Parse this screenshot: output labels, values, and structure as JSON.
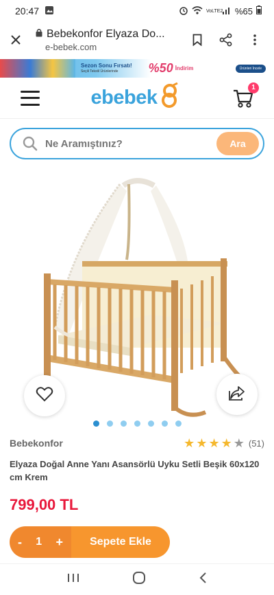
{
  "status_bar": {
    "time": "20:47",
    "battery": "%65",
    "network": "VoLTE2"
  },
  "browser": {
    "page_title": "Bebekonfor Elyaza Do...",
    "url": "e-bebek.com"
  },
  "promo": {
    "title": "Sezon Sonu Fırsatı!",
    "subtitle": "Seçili Tekstil Ürünlerinde",
    "discount": "%50",
    "discount_word": "İndirim",
    "button": "Ürünleri İncele"
  },
  "header": {
    "logo_text": "ebebek",
    "cart_count": "1"
  },
  "search": {
    "placeholder": "Ne Aramıştınız?",
    "button_label": "Ara"
  },
  "gallery": {
    "image_count": 7,
    "active_index": 0
  },
  "product": {
    "brand": "Bebekonfor",
    "rating_stars": 4,
    "rating_count": "(51)",
    "title": "Elyaza Doğal Anne Yanı Asansörlü Uyku Setli Beşik 60x120 cm Krem",
    "price": "799,00 TL"
  },
  "cart_bar": {
    "minus": "-",
    "quantity": "1",
    "plus": "+",
    "add_label": "Sepete Ekle"
  },
  "colors": {
    "brand_blue": "#3aa3dc",
    "price_red": "#e8173a",
    "cta_orange": "#f7962e",
    "star_yellow": "#f5b82e"
  }
}
